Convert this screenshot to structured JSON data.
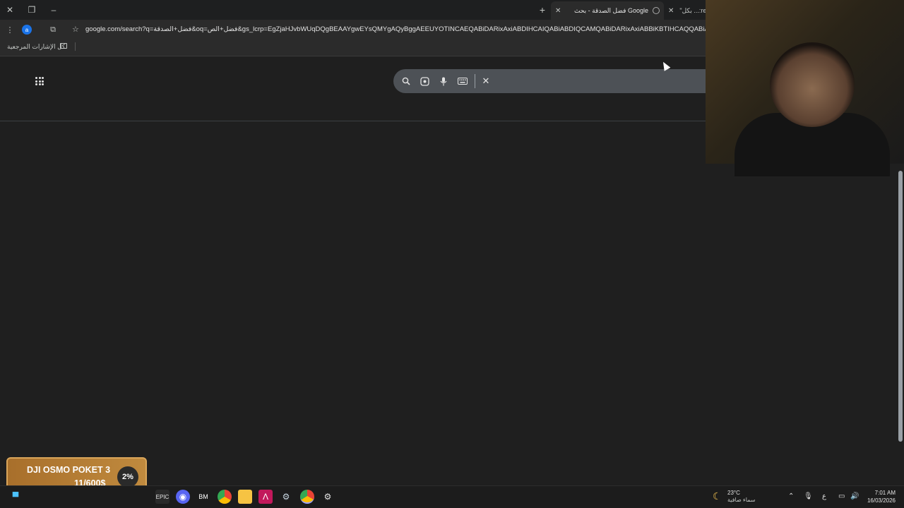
{
  "browser": {
    "tabs": [
      {
        "title": "فضل الصدقة - بحث Google",
        "active": true
      },
      {
        "title": "\"بكل ...:re",
        "active": false
      }
    ],
    "profile_initial": "a",
    "url": "google.com/search?q=فضل+الصدقة&oq=فضل+الص&gs_lcrp=EgZjaHJvbWUqDQgBEAAYgwEYsQMYgAQyBggAEEUYOTINCAEQABiDARixAxiABDIHCAIQABiABDIQCAMQABiDARixAxiABBiKBTIHCAQQABiABDIHCAUQ",
    "bookmarks_all_label": "كل الإشارات المرجعية"
  },
  "search": {
    "query": ""
  },
  "donation": {
    "title": "DJI OSMO POKET 3",
    "amount": "11/600$",
    "percent": "2%",
    "progress": 0.02
  },
  "taskbar": {
    "apps": [
      "start-icon",
      "epic-games-icon",
      "discord-icon",
      "bm-icon",
      "chrome-icon",
      "file-explorer-icon",
      "affinity-icon",
      "steam-icon",
      "chrome-active-icon",
      "settings-icon"
    ],
    "weather_temp": "23°C",
    "weather_desc": "سماء صافية",
    "language": "ع",
    "time": "7:01 AM",
    "date": "16/03/2026"
  },
  "colors": {
    "page_bg": "#1f1f1f",
    "searchbar_bg": "#4d5156",
    "donation_bg": "#b87e35"
  }
}
